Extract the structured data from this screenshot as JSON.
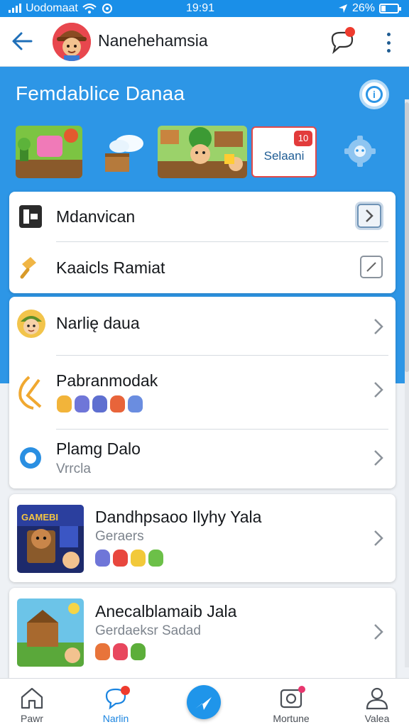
{
  "status": {
    "carrier": "Uodomaat",
    "time": "19:91",
    "battery": "26%",
    "battery_level": 0.26
  },
  "header": {
    "title": "Nanehehamsia"
  },
  "banner": {
    "title": "Femdablice Danaa",
    "select_card": {
      "badge": "10",
      "label": "Selaani"
    }
  },
  "menu_card": {
    "items": [
      {
        "label": "Mdanvican"
      },
      {
        "label": "Kaaicls Ramiat"
      }
    ]
  },
  "list_card": {
    "items": [
      {
        "title": "Narlię daua"
      },
      {
        "title": "Pabranmodak"
      },
      {
        "title": "Plamg Dalo",
        "subtitle": "Vrrcla"
      }
    ]
  },
  "games": [
    {
      "title": "Dandhpsaoo Ilyhy Yala",
      "subtitle": "Geraers",
      "art_text": "GAMEBI"
    },
    {
      "title": "Anecalblamaib Jala",
      "subtitle": "Gerdaeksr Sadad"
    }
  ],
  "bottom_nav": {
    "items": [
      {
        "label": "Pawr"
      },
      {
        "label": "Narlin"
      },
      {
        "label": "Mortune"
      },
      {
        "label": "Valea"
      }
    ]
  },
  "colors": {
    "primary": "#2d96e6",
    "accent_red": "#ee3b2e",
    "title_text": "#15181c",
    "muted_text": "#7d848d"
  }
}
